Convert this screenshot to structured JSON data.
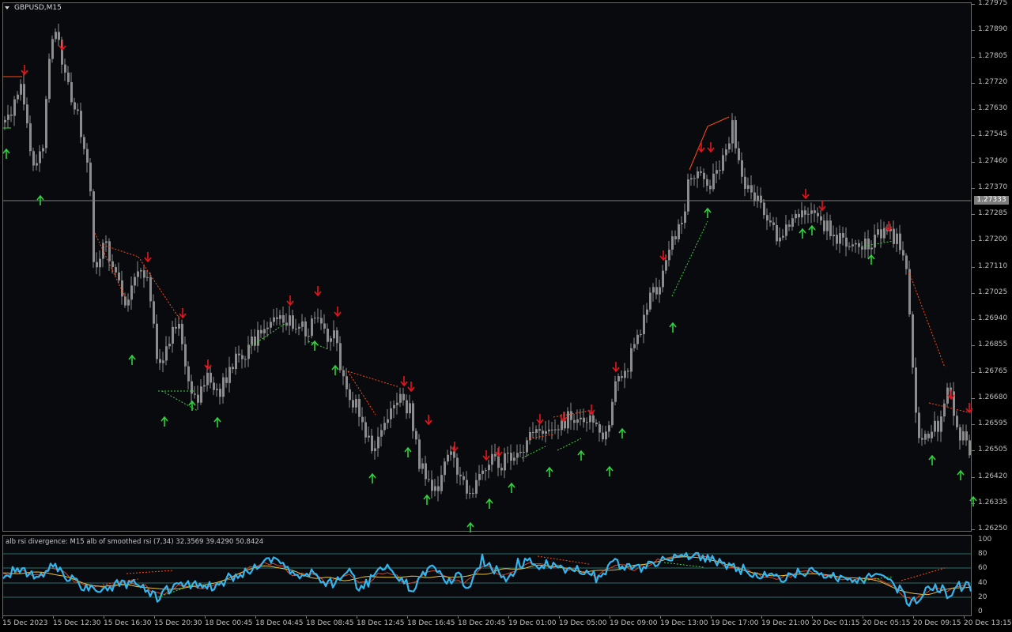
{
  "chart": {
    "symbol_label": "GBPUSD,M15",
    "current_price": "1.27333",
    "price_axis": [
      "1.27975",
      "1.27890",
      "1.27805",
      "1.27720",
      "1.27630",
      "1.27545",
      "1.27460",
      "1.27370",
      "1.27285",
      "1.27200",
      "1.27110",
      "1.27025",
      "1.26940",
      "1.26855",
      "1.26765",
      "1.26680",
      "1.26595",
      "1.26505",
      "1.26420",
      "1.26335",
      "1.26250"
    ],
    "time_axis": [
      "15 Dec 2023",
      "15 Dec 12:30",
      "15 Dec 16:30",
      "15 Dec 20:30",
      "18 Dec 00:45",
      "18 Dec 04:45",
      "18 Dec 08:45",
      "18 Dec 12:45",
      "18 Dec 16:45",
      "18 Dec 20:45",
      "19 Dec 01:00",
      "19 Dec 05:00",
      "19 Dec 09:00",
      "19 Dec 13:00",
      "19 Dec 17:00",
      "19 Dec 21:00",
      "20 Dec 01:15",
      "20 Dec 05:15",
      "20 Dec 09:15",
      "20 Dec 13:15"
    ],
    "colors": {
      "background": "#090a0e",
      "candle": "#8c8c8c",
      "up_arrow": "#2fd33a",
      "down_arrow": "#e8141c",
      "bear_divergence": "#ff4a12",
      "bull_divergence": "#3cd43c",
      "rsi_line": "#33b5ee",
      "smooth_line": "#e8c23a",
      "signal_line": "#d8452a"
    }
  },
  "indicator": {
    "title": "alb rsi divergence: M15  alb of smoothed rsi  (7,34) 32.3569 39.4290 50.8424",
    "axis": [
      "100",
      "80",
      "60",
      "40",
      "20",
      "0"
    ]
  },
  "chart_data": {
    "type": "line",
    "series": [
      {
        "name": "GBPUSD,M15",
        "x": [
          "15 Dec 2023",
          "15 Dec 12:30",
          "15 Dec 16:30",
          "15 Dec 20:30",
          "18 Dec 00:45",
          "18 Dec 04:45",
          "18 Dec 08:45",
          "18 Dec 12:45",
          "18 Dec 16:45",
          "18 Dec 20:45",
          "19 Dec 01:00",
          "19 Dec 05:00",
          "19 Dec 09:00",
          "19 Dec 13:00",
          "19 Dec 17:00",
          "19 Dec 21:00",
          "20 Dec 01:15",
          "20 Dec 05:15",
          "20 Dec 09:15",
          "20 Dec 13:15"
        ],
        "values": [
          1.2765,
          1.2765,
          1.2711,
          1.267,
          1.268,
          1.2696,
          1.269,
          1.2668,
          1.2639,
          1.2645,
          1.2658,
          1.2662,
          1.2678,
          1.2742,
          1.2748,
          1.2725,
          1.2718,
          1.272,
          1.2658,
          1.265
        ]
      }
    ],
    "xlabel": "",
    "ylabel": "",
    "ylim": [
      1.262,
      1.28
    ]
  }
}
